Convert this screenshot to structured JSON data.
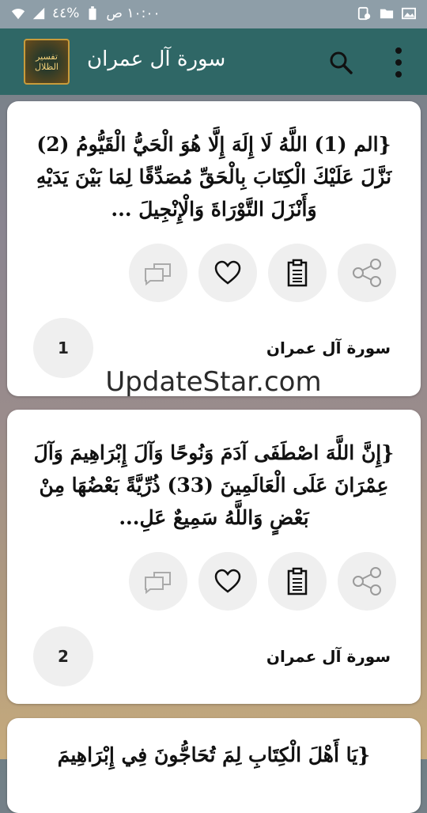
{
  "status_bar": {
    "time": "١٠:٠٠ ص",
    "battery": "%٤٤"
  },
  "app_bar": {
    "title": "سورة آل عمران",
    "logo_text_line1": "تفسير",
    "logo_text_line2": "الظلال"
  },
  "cards": [
    {
      "verse": "{الم (1) اللَّهُ لَا إِلَهَ إِلَّا هُوَ الْحَيُّ الْقَيُّومُ (2) نَزَّلَ عَلَيْكَ الْكِتَابَ بِالْحَقِّ مُصَدِّقًا لِمَا بَيْنَ يَدَيْهِ وَأَنْزَلَ التَّوْرَاةَ وَالْإِنْجِيلَ ...",
      "surah": "سورة آل عمران",
      "number": "1"
    },
    {
      "verse": "{إِنَّ اللَّهَ اصْطَفَى آدَمَ وَنُوحًا وَآلَ إِبْرَاهِيمَ وَآلَ عِمْرَانَ عَلَى الْعَالَمِينَ (33) ذُرِّيَّةً بَعْضُهَا مِنْ بَعْضٍ وَاللَّهُ سَمِيعٌ عَلِ...",
      "surah": "سورة آل عمران",
      "number": "2"
    },
    {
      "verse": "{يَا أَهْلَ الْكِتَابِ لِمَ تُحَاجُّونَ فِي إِبْرَاهِيمَ"
    }
  ],
  "watermark": "UpdateStar.com",
  "icons": {
    "share": "share-icon",
    "copy": "clipboard-icon",
    "favorite": "heart-icon",
    "comments": "comments-icon",
    "search": "search-icon",
    "more": "more-vert-icon"
  },
  "colors": {
    "app_bar": "#2f6766",
    "status_bar": "#8e9ea8",
    "card": "#ffffff",
    "button_bg": "#efefef"
  }
}
